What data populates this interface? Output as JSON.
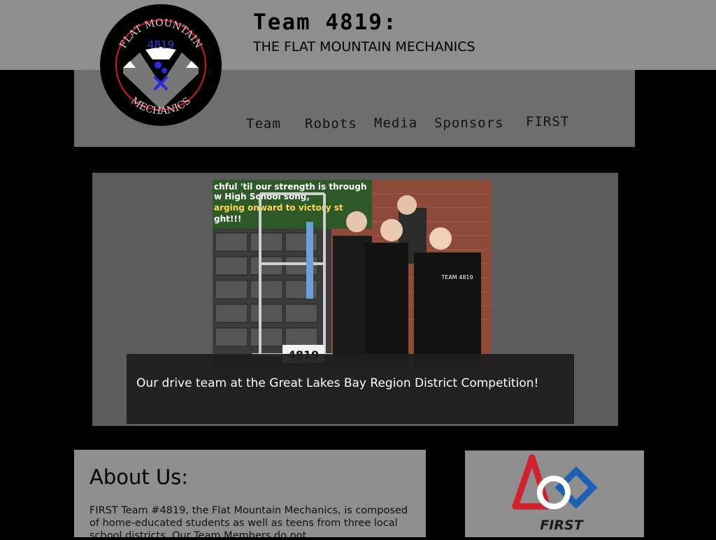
{
  "header": {
    "title": "Team 4819:",
    "subtitle": "THE FLAT MOUNTAIN MECHANICS",
    "logo": {
      "top_text": "FLAT MOUNTAIN",
      "number": "4819",
      "bottom_text": "MECHANICS"
    }
  },
  "nav": {
    "items": [
      "Team",
      "Robots",
      "Media",
      "Sponsors",
      "FIRST"
    ]
  },
  "slideshow": {
    "caption": "Our drive team at the Great Lakes Bay Region District Competition!",
    "banner_lines": [
      "chful 'til our strength is through",
      "w High School song,",
      "arging onward to victory st",
      "ght!!!"
    ],
    "robot_number": "4819",
    "shirt_text": "TEAM 4819"
  },
  "about": {
    "heading": "About Us:",
    "body": "FIRST Team #4819, the Flat Mountain Mechanics, is composed of home-educated students as well as teens from three local school districts. Our Team Members do not"
  },
  "first_logo": {
    "label": "FIRST"
  },
  "colors": {
    "header_bg": "#8e8e8e",
    "nav_bg": "#6e6e6e",
    "slideshow_bg": "#5d5d5d",
    "caption_bg": "#1e1e1e",
    "first_red": "#d2222e",
    "first_blue": "#1a60b4",
    "logo_blue": "#3a3ad6"
  }
}
